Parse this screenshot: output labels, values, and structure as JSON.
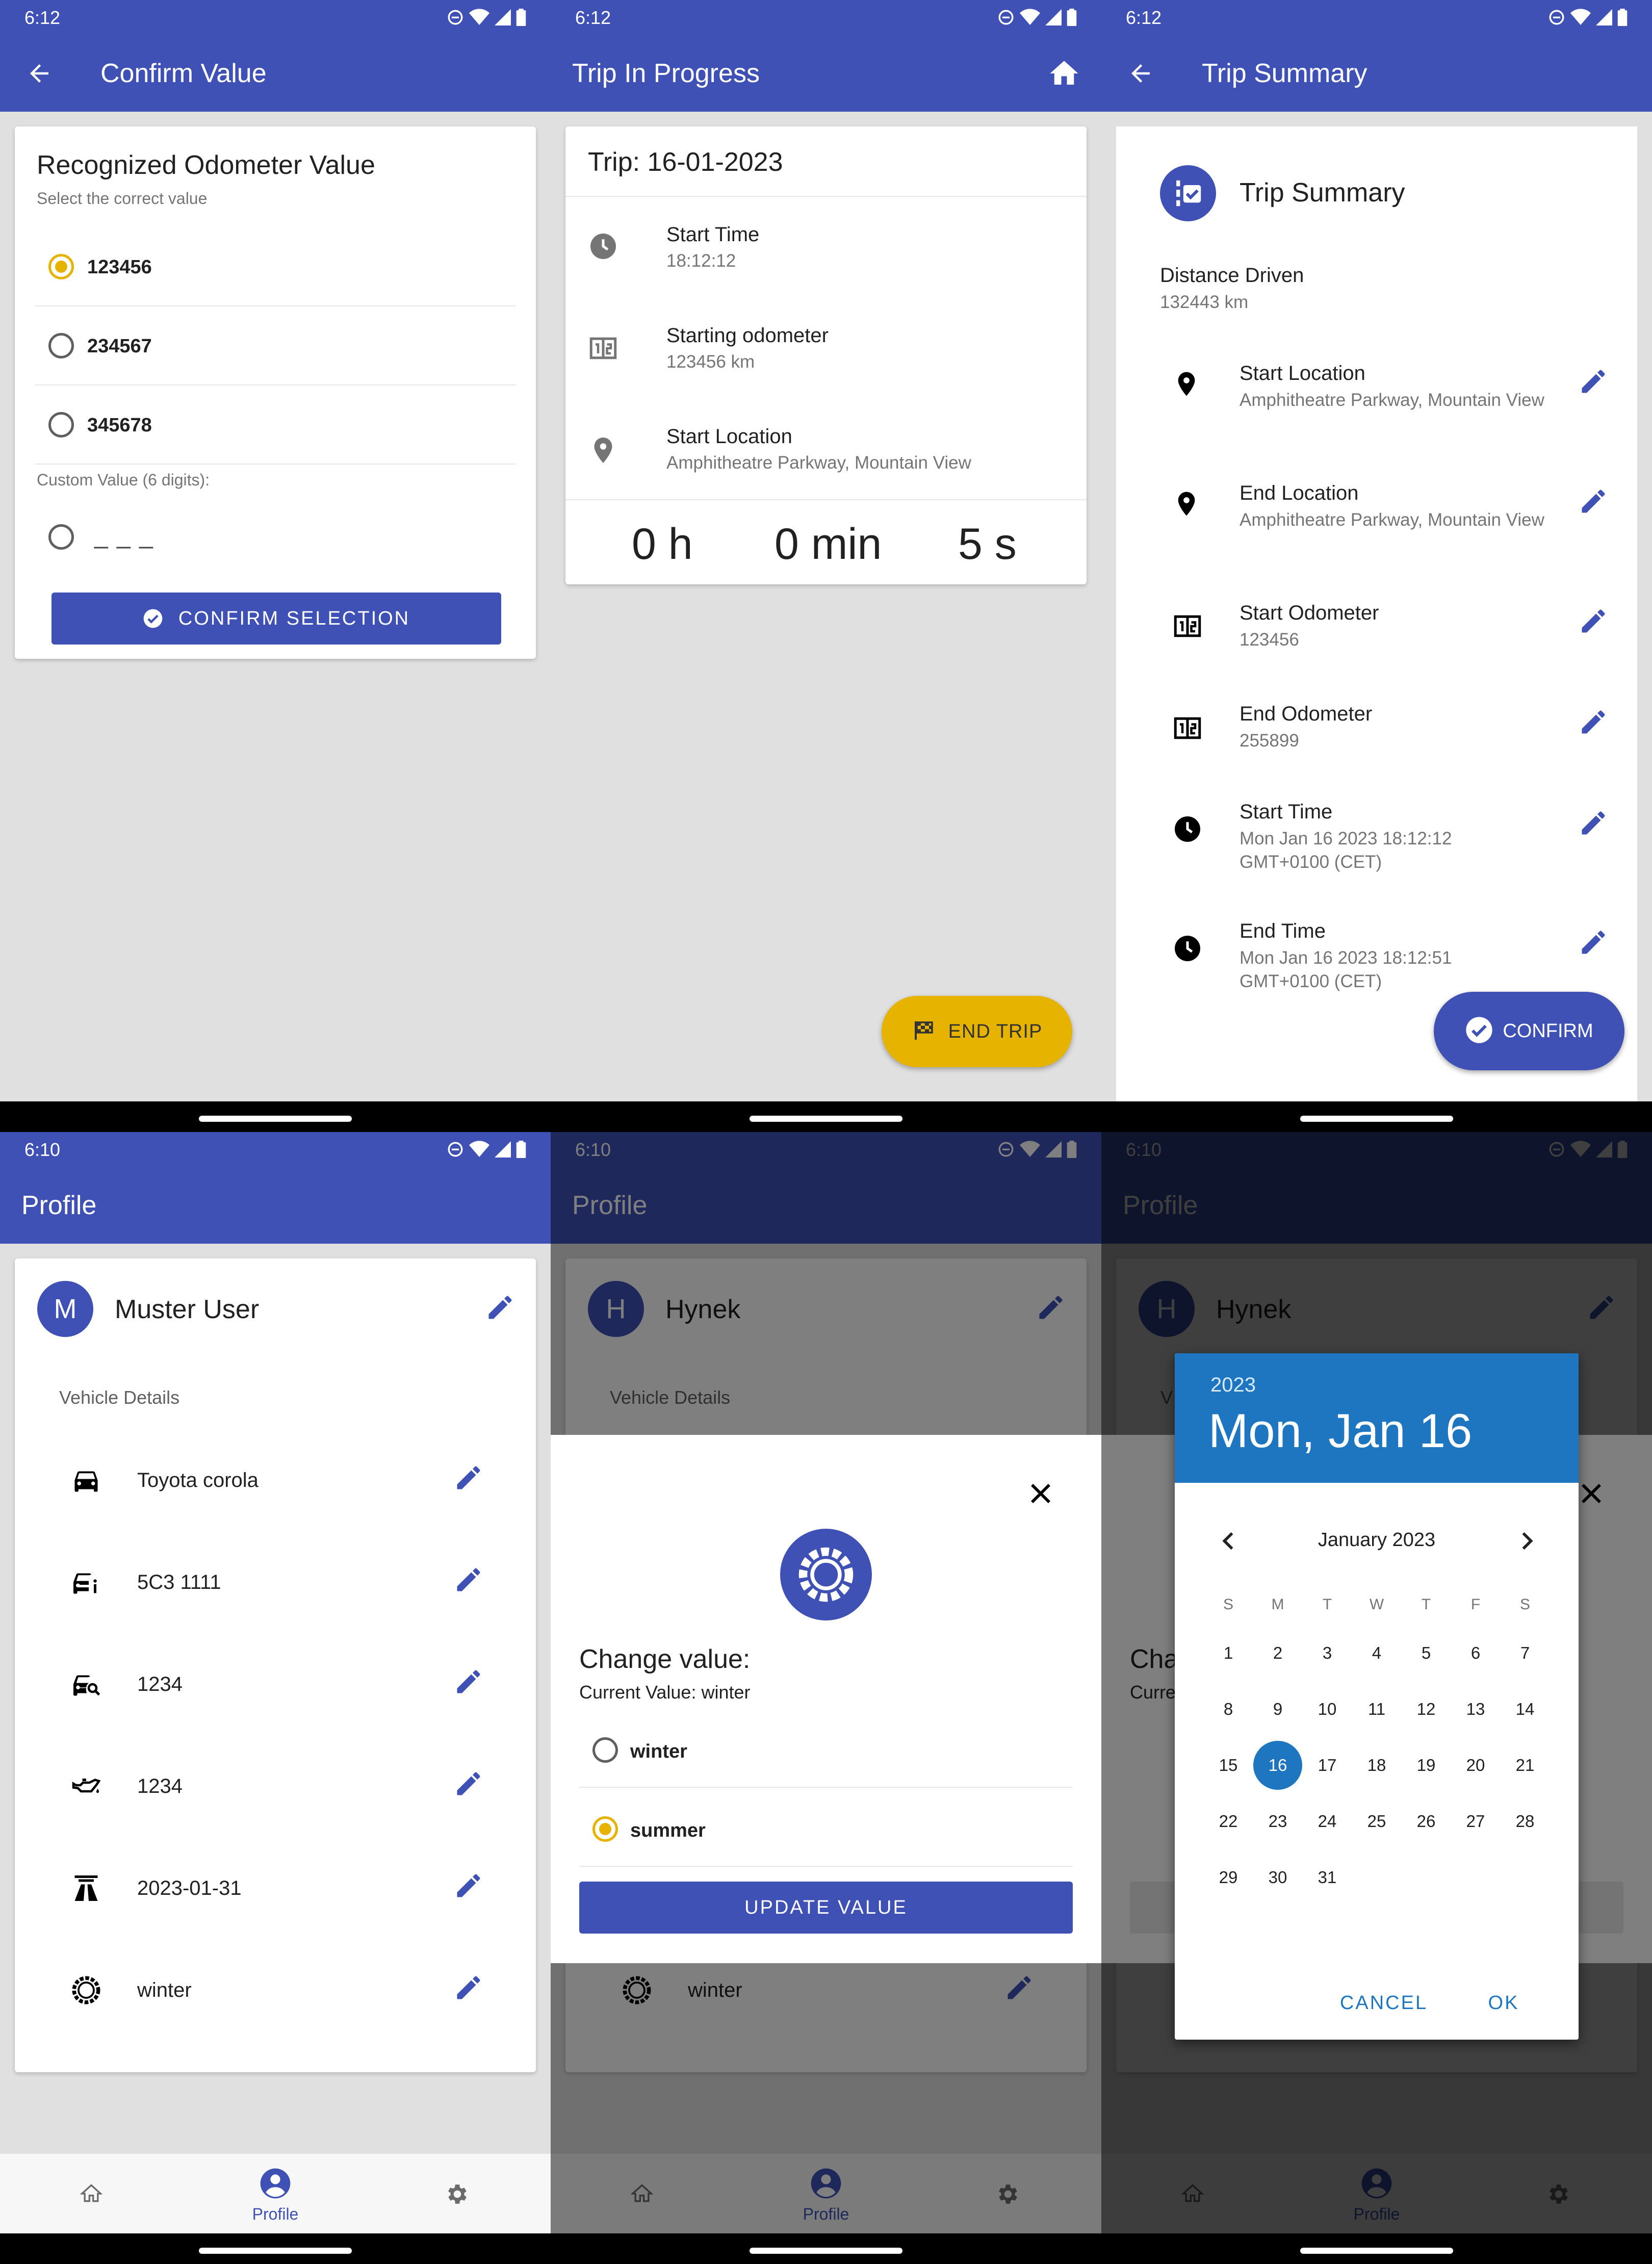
{
  "status_bar": {
    "time_top": "6:12",
    "time_bottom": "6:10"
  },
  "screen1": {
    "title": "Confirm Value",
    "card_title": "Recognized Odometer Value",
    "card_subtitle": "Select the correct value",
    "options": [
      "123456",
      "234567",
      "345678"
    ],
    "selected_index": 0,
    "custom_label": "Custom Value (6 digits):",
    "custom_placeholder": "_ _ _",
    "confirm_label": "CONFIRM SELECTION"
  },
  "screen2": {
    "title": "Trip In Progress",
    "trip_title": "Trip: 16-01-2023",
    "start_time_label": "Start Time",
    "start_time_value": "18:12:12",
    "odometer_label": "Starting odometer",
    "odometer_value": "123456 km",
    "location_label": "Start Location",
    "location_value": "Amphitheatre Parkway, Mountain View",
    "timer": {
      "h": "0 h",
      "min": "0 min",
      "s": "5 s"
    },
    "end_trip_label": "END TRIP"
  },
  "screen3": {
    "title": "Trip Summary",
    "header": "Trip Summary",
    "distance_label": "Distance Driven",
    "distance_value": "132443 km",
    "rows": [
      {
        "label": "Start Location",
        "value": "Amphitheatre Parkway, Mountain View"
      },
      {
        "label": "End Location",
        "value": "Amphitheatre Parkway, Mountain View"
      },
      {
        "label": "Start Odometer",
        "value": "123456"
      },
      {
        "label": "End Odometer",
        "value": "255899"
      },
      {
        "label": "Start Time",
        "value": "Mon Jan 16 2023 18:12:12 GMT+0100 (CET)"
      },
      {
        "label": "End Time",
        "value": "Mon Jan 16 2023 18:12:51 GMT+0100 (CET)"
      }
    ],
    "confirm_label": "CONFIRM"
  },
  "screen4": {
    "title": "Profile",
    "avatar_letter": "M",
    "user_name": "Muster User",
    "section_label": "Vehicle Details",
    "rows": [
      "Toyota corola",
      "5C3 1111",
      "1234",
      "1234",
      "2023-01-31",
      "winter"
    ],
    "nav_profile_label": "Profile"
  },
  "screen5": {
    "title": "Profile",
    "avatar_letter": "H",
    "user_name": "Hynek",
    "section_label": "Vehicle Details",
    "row_visible": "winter",
    "dialog_title": "Change value:",
    "dialog_current": "Current Value: winter",
    "options": [
      "winter",
      "summer"
    ],
    "selected_index": 1,
    "update_label": "UPDATE VALUE",
    "nav_profile_label": "Profile"
  },
  "screen6": {
    "title": "Profile",
    "avatar_letter": "H",
    "user_name": "Hynek",
    "behind_title": "Cha",
    "behind_sub": "Curre",
    "behind_row_letter": "V",
    "picker_year": "2023",
    "picker_date": "Mon, Jan 16",
    "month_label": "January 2023",
    "weekdays": [
      "S",
      "M",
      "T",
      "W",
      "T",
      "F",
      "S"
    ],
    "days": [
      "1",
      "2",
      "3",
      "4",
      "5",
      "6",
      "7",
      "8",
      "9",
      "10",
      "11",
      "12",
      "13",
      "14",
      "15",
      "16",
      "17",
      "18",
      "19",
      "20",
      "21",
      "22",
      "23",
      "24",
      "25",
      "26",
      "27",
      "28",
      "29",
      "30",
      "31"
    ],
    "selected_day": "16",
    "cancel_label": "CANCEL",
    "ok_label": "OK",
    "nav_profile_label": "Profile"
  },
  "colors": {
    "primary": "#3f51b5",
    "accent": "#e6b400",
    "picker_header": "#1e76c0"
  }
}
